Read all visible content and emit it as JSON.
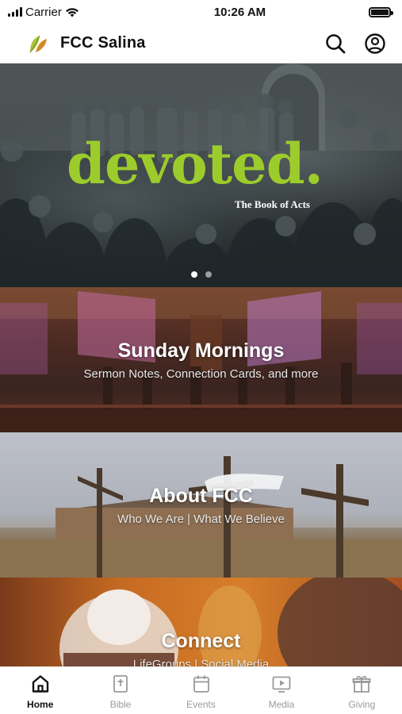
{
  "status_bar": {
    "carrier": "Carrier",
    "time": "10:26 AM"
  },
  "header": {
    "title": "FCC Salina",
    "logo_icon": "leaf-logo-icon",
    "search_icon": "search-icon",
    "account_icon": "account-circle-icon"
  },
  "hero": {
    "title": "devoted.",
    "subtitle": "The Book of Acts",
    "pages": 2,
    "active_page": 1,
    "title_color": "#9ccc2b"
  },
  "tiles": [
    {
      "title": "Sunday Mornings",
      "subtitle": "Sermon Notes, Connection Cards, and more"
    },
    {
      "title": "About FCC",
      "subtitle": "Who We Are | What We Believe"
    },
    {
      "title": "Connect",
      "subtitle": "LifeGroups | Social Media"
    }
  ],
  "tab_bar": {
    "active": "Home",
    "items": [
      {
        "label": "Home",
        "icon": "home-icon"
      },
      {
        "label": "Bible",
        "icon": "bible-icon"
      },
      {
        "label": "Events",
        "icon": "calendar-icon"
      },
      {
        "label": "Media",
        "icon": "media-icon"
      },
      {
        "label": "Giving",
        "icon": "gift-icon"
      }
    ]
  }
}
